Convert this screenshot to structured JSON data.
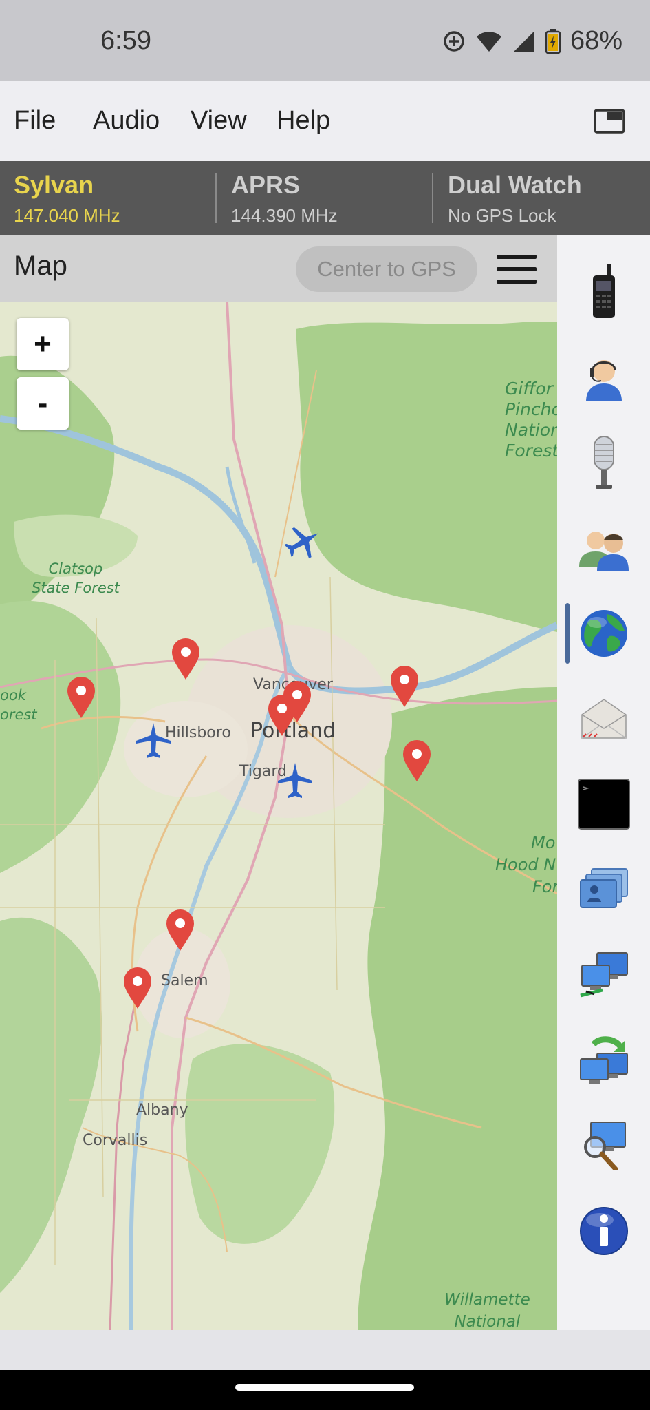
{
  "status_bar": {
    "time": "6:59",
    "battery": "68%"
  },
  "menu": {
    "file": "File",
    "audio": "Audio",
    "view": "View",
    "help": "Help"
  },
  "radio": {
    "channel_a": {
      "name": "Sylvan",
      "freq": "147.040 MHz",
      "color": "#e8d44d"
    },
    "channel_b": {
      "name": "APRS",
      "freq": "144.390 MHz"
    },
    "channel_c": {
      "name": "Dual Watch",
      "status": "No GPS Lock"
    }
  },
  "map_panel": {
    "title": "Map",
    "center_button": "Center to GPS",
    "zoom_in": "+",
    "zoom_out": "-",
    "labels": {
      "gifford": "Gifford Pinchot National Forest",
      "gifford_1": "Giffor",
      "gifford_2": "Pincho",
      "gifford_3": "Nation",
      "gifford_4": "Forest",
      "clatsop_1": "Clatsop",
      "clatsop_2": "State Forest",
      "tillamook_1": "ook",
      "tillamook_2": "orest",
      "vancouver": "Vancouver",
      "hillsboro": "Hillsboro",
      "portland": "Portland",
      "tigard": "Tigard",
      "mthood_1": "Mo",
      "mthood_2": "Hood N",
      "mthood_3": "For",
      "salem": "Salem",
      "albany": "Albany",
      "corvallis": "Corvallis",
      "willamette_1": "Willamette",
      "willamette_2": "National"
    },
    "marker_color": "#e2483f",
    "plane_color": "#2e62c8"
  },
  "sidebar": {
    "items": [
      {
        "icon": "handheld-radio-icon",
        "selected": false
      },
      {
        "icon": "operator-headset-icon",
        "selected": false
      },
      {
        "icon": "microphone-icon",
        "selected": false
      },
      {
        "icon": "contacts-icon",
        "selected": false
      },
      {
        "icon": "globe-icon",
        "selected": true
      },
      {
        "icon": "mail-icon",
        "selected": false
      },
      {
        "icon": "terminal-icon",
        "selected": false
      },
      {
        "icon": "bbs-icon",
        "selected": false
      },
      {
        "icon": "network-icon",
        "selected": false
      },
      {
        "icon": "sync-icon",
        "selected": false
      },
      {
        "icon": "search-icon",
        "selected": false
      },
      {
        "icon": "info-icon",
        "selected": false
      }
    ]
  }
}
